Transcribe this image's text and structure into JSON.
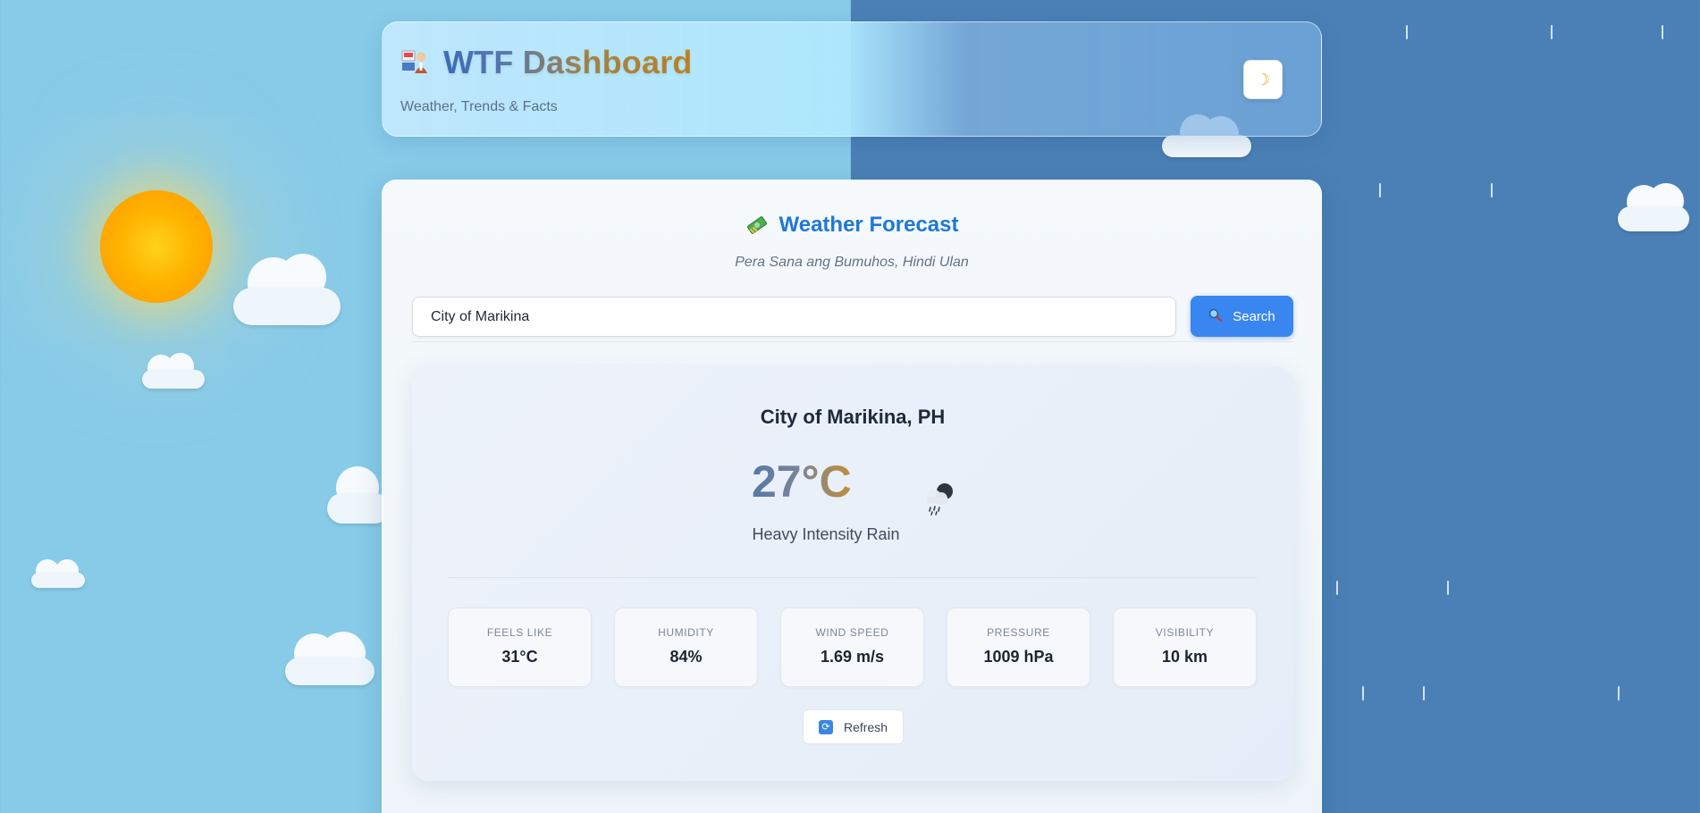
{
  "header": {
    "title": "WTF Dashboard",
    "subtitle": "Weather, Trends & Facts",
    "theme_toggle_icon": "moon-icon",
    "brand_icon": "news-anchor-icon"
  },
  "forecast": {
    "title": "Weather Forecast",
    "title_icon": "money-icon",
    "tagline": "Pera Sana ang Bumuhos, Hindi Ulan",
    "search": {
      "value": "City of Marikina",
      "button_label": "Search"
    }
  },
  "weather": {
    "city": "City of Marikina, PH",
    "temperature": "27°C",
    "condition": "Heavy Intensity Rain",
    "condition_icon": "rain-cloud-icon",
    "stats": [
      {
        "label": "FEELS LIKE",
        "value": "31°C"
      },
      {
        "label": "HUMIDITY",
        "value": "84%"
      },
      {
        "label": "WIND SPEED",
        "value": "1.69 m/s"
      },
      {
        "label": "PRESSURE",
        "value": "1009 hPa"
      },
      {
        "label": "VISIBILITY",
        "value": "10 km"
      }
    ],
    "refresh_label": "Refresh"
  },
  "colors": {
    "sky_left": "#87cbe9",
    "sky_right": "#4a80b6",
    "accent": "#3a86f0",
    "title_blue": "#1f78d6"
  }
}
